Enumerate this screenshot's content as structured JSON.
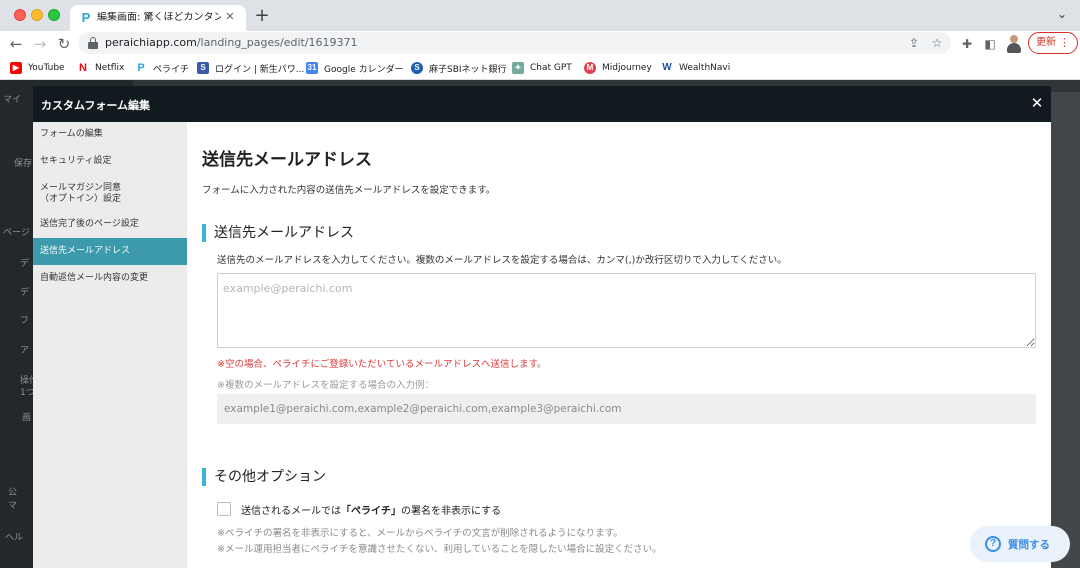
{
  "browser": {
    "tab_title": "編集画面: 驚くほどカンタン！無料",
    "url_host": "peraichiapp.com",
    "url_path": "/landing_pages/edit/1619371",
    "update_label": "更新",
    "bookmarks": [
      {
        "label": "YouTube",
        "icon": "youtube-icon",
        "color": "#ff0000"
      },
      {
        "label": "Netflix",
        "icon": "netflix-icon",
        "color": "#e50914"
      },
      {
        "label": "ペライチ",
        "icon": "peraichi-icon",
        "color": "#2aa5d8"
      },
      {
        "label": "ログイン | 新生パワ...",
        "icon": "shinsei-icon",
        "color": "#3b5ba8"
      },
      {
        "label": "Google カレンダー",
        "icon": "calendar-icon",
        "color": "#4285f4"
      },
      {
        "label": "麻子SBIネット銀行",
        "icon": "sbi-icon",
        "color": "#1a5fb4"
      },
      {
        "label": "Chat GPT",
        "icon": "chatgpt-icon",
        "color": "#74aa9c"
      },
      {
        "label": "Midjourney",
        "icon": "midjourney-icon",
        "color": "#e23f50"
      },
      {
        "label": "WealthNavi",
        "icon": "wealthnavi-icon",
        "color": "#1f4fa3"
      }
    ]
  },
  "background_sidebar": {
    "fragments": [
      "マイ",
      "保存",
      "ページ",
      "デ",
      "デ",
      "フ",
      "ア",
      "操作",
      "1つ",
      "画",
      "公",
      "マ",
      "ヘル"
    ]
  },
  "modal": {
    "title": "カスタムフォーム編集",
    "nav": [
      {
        "label": "フォームの編集"
      },
      {
        "label": "セキュリティ設定"
      },
      {
        "label": "メールマガジン同意\n（オプトイン）設定"
      },
      {
        "label": "送信完了後のページ設定"
      },
      {
        "label": "送信先メールアドレス",
        "active": true
      },
      {
        "label": "自動返信メール内容の変更"
      }
    ],
    "page_title": "送信先メールアドレス",
    "page_desc": "フォームに入力された内容の送信先メールアドレスを設定できます。",
    "section1": {
      "heading": "送信先メールアドレス",
      "instruction": "送信先のメールアドレスを入力してください。複数のメールアドレスを設定する場合は、カンマ(,)か改行区切りで入力してください。",
      "placeholder": "example@peraichi.com",
      "value": "",
      "warning": "※空の場合、ペライチにご登録いただいているメールアドレスへ送信します。",
      "example_note": "※複数のメールアドレスを設定する場合の入力例：",
      "example_value": "example1@peraichi.com,example2@peraichi.com,example3@peraichi.com"
    },
    "section2": {
      "heading": "その他オプション",
      "option_prefix": "送信されるメールでは",
      "option_brand": "「ペライチ」",
      "option_suffix": "の署名を非表示にする",
      "option_checked": false,
      "note1": "※ペライチの署名を非表示にすると、メールからペライチの文言が削除されるようになります。",
      "note2": "※メール運用担当者にペライチを意識させたくない、利用していることを隠したい場合に設定ください。"
    }
  },
  "help": {
    "label": "質問する"
  }
}
